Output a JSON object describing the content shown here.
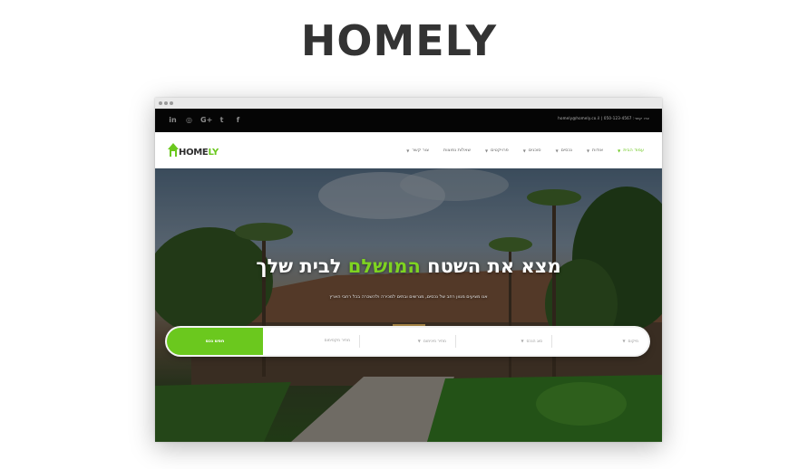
{
  "page": {
    "title": "HOMELY"
  },
  "topbar": {
    "social_icons": [
      "linkedin-icon",
      "instagram-icon",
      "google-plus-icon",
      "twitter-icon",
      "facebook-icon"
    ],
    "social_glyphs": [
      "in",
      "◎",
      "G+",
      "t",
      "f"
    ],
    "contact": "homely@homely.co.il | 050-123-4567 :צרו קשר"
  },
  "navbar": {
    "logo": {
      "prefix": "HOME",
      "accent": "LY"
    },
    "menu": [
      {
        "label": "עמוד הבית",
        "active": true
      },
      {
        "label": "אודות",
        "active": false
      },
      {
        "label": "נכסים",
        "active": false
      },
      {
        "label": "סוכנים",
        "active": false
      },
      {
        "label": "פרויקטים",
        "active": false
      },
      {
        "label": "שאלות נפוצות",
        "active": false
      },
      {
        "label": "צור קשר",
        "active": false
      }
    ]
  },
  "hero": {
    "headline_before": "מצא את השטח ",
    "headline_highlight": "המושלם",
    "headline_after": " לבית שלך",
    "subtitle": "אנו מציעים מגוון רחב של נכסים, מגרשים ובתים למכירה ולהשכרה בכל רחבי הארץ"
  },
  "search": {
    "button_label": "חפש נכס",
    "fields": [
      "מיקום",
      "סוג הנכס",
      "מחיר מינימום",
      "מחיר מקסימום"
    ]
  },
  "colors": {
    "accent": "#6bc81e",
    "topbar": "#050505",
    "heading": "#333333"
  }
}
